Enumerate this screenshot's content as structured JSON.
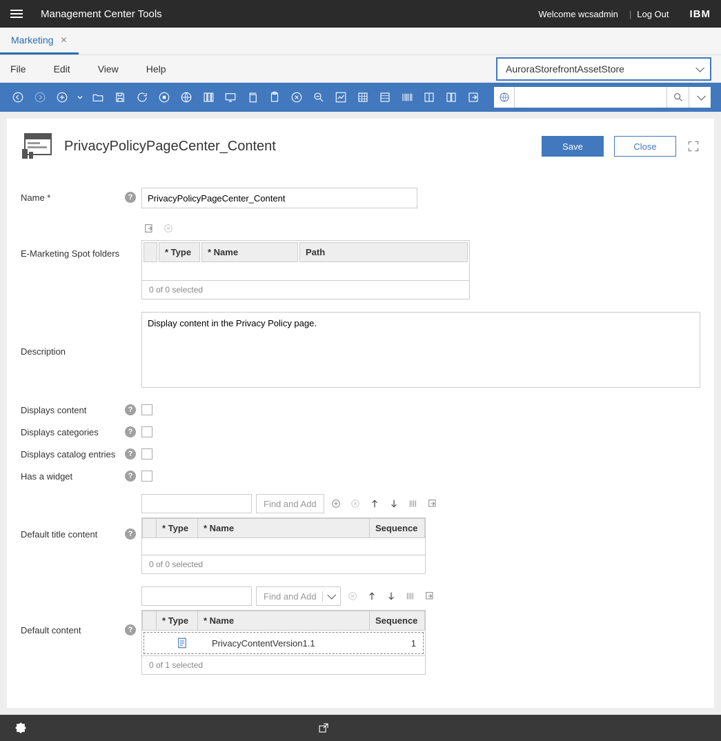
{
  "header": {
    "app_title": "Management Center Tools",
    "welcome_prefix": "Welcome ",
    "username": "wcsadmin",
    "logout": "Log Out",
    "logo": "IBM"
  },
  "tabs": [
    {
      "label": "Marketing"
    }
  ],
  "menu": {
    "file": "File",
    "edit": "Edit",
    "view": "View",
    "help": "Help",
    "store_selected": "AuroraStorefrontAssetStore"
  },
  "search": {
    "placeholder": ""
  },
  "panel": {
    "title": "PrivacyPolicyPageCenter_Content",
    "save": "Save",
    "close": "Close"
  },
  "form": {
    "name_label": "Name *",
    "name_value": "PrivacyPolicyPageCenter_Content",
    "espot_label": "E-Marketing Spot folders",
    "description_label": "Description",
    "description_value": "Display content in the Privacy Policy page.",
    "displays_content_label": "Displays content",
    "displays_categories_label": "Displays categories",
    "displays_catalog_label": "Displays catalog entries",
    "has_widget_label": "Has a widget",
    "default_title_content_label": "Default title content",
    "default_content_label": "Default content",
    "find_and_add": "Find and Add"
  },
  "espot_table": {
    "col_type": "* Type",
    "col_name": "* Name",
    "col_path": "Path",
    "footer": "0 of 0 selected"
  },
  "title_table": {
    "col_type": "* Type",
    "col_name": "* Name",
    "col_seq": "Sequence",
    "footer": "0 of 0 selected"
  },
  "content_table": {
    "col_type": "* Type",
    "col_name": "* Name",
    "col_seq": "Sequence",
    "rows": [
      {
        "name": "PrivacyContentVersion1.1",
        "sequence": "1"
      }
    ],
    "footer": "0 of 1 selected"
  }
}
